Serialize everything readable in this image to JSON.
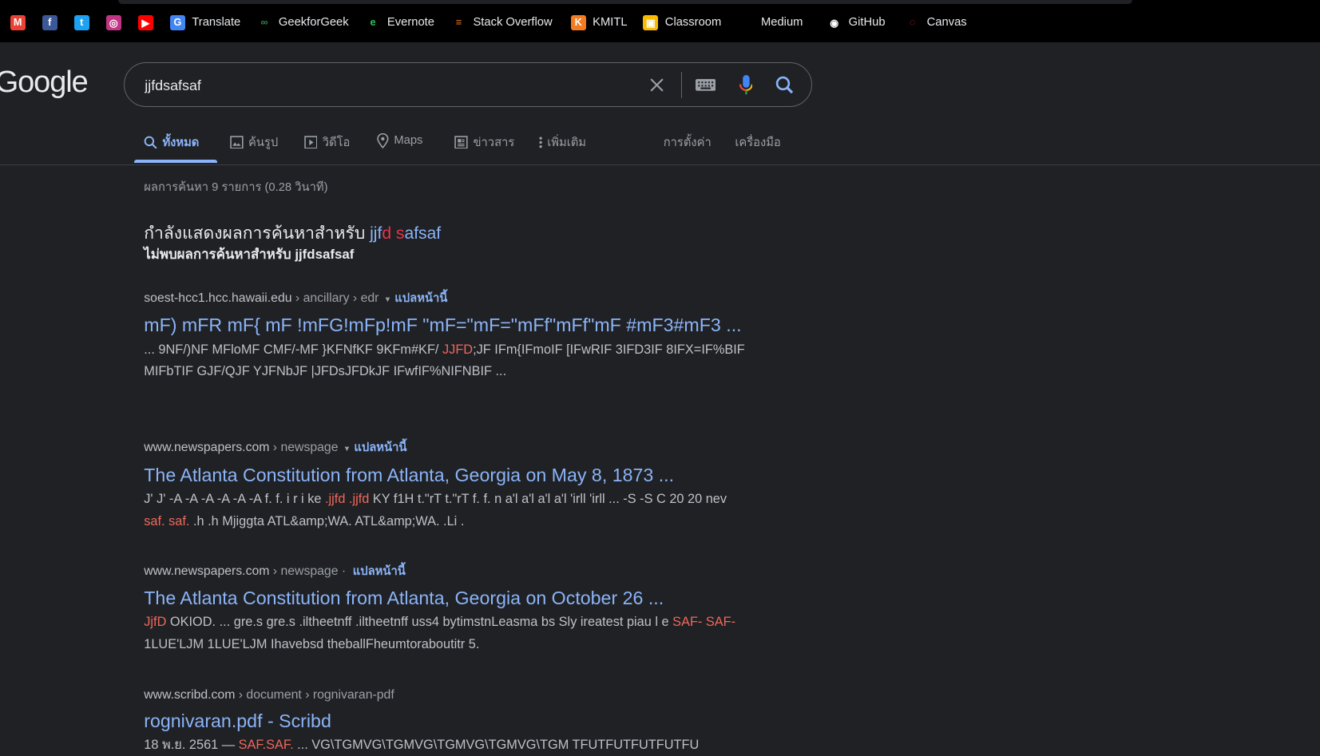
{
  "bookmarks": [
    {
      "label": "",
      "icon": "gmail-icon",
      "color": "#ea4335",
      "glyph": "M"
    },
    {
      "label": "",
      "icon": "facebook-icon",
      "color": "#3b5998",
      "glyph": "f"
    },
    {
      "label": "",
      "icon": "twitter-icon",
      "color": "#1da1f2",
      "glyph": "t"
    },
    {
      "label": "",
      "icon": "instagram-icon",
      "color": "#c13584",
      "glyph": "◎"
    },
    {
      "label": "",
      "icon": "youtube-icon",
      "color": "#ff0000",
      "glyph": "▶"
    },
    {
      "label": "Translate",
      "icon": "google-translate-icon",
      "color": "#4285f4",
      "glyph": "G"
    },
    {
      "label": "GeekforGeek",
      "icon": "geeksforgeeks-icon",
      "color": "#2f8d46",
      "glyph": "∞"
    },
    {
      "label": "Evernote",
      "icon": "evernote-icon",
      "color": "#2dbe60",
      "glyph": "e"
    },
    {
      "label": "Stack Overflow",
      "icon": "stackoverflow-icon",
      "color": "#f48024",
      "glyph": "≡"
    },
    {
      "label": "KMITL",
      "icon": "kmitl-icon",
      "color": "#f47b20",
      "glyph": "K"
    },
    {
      "label": "Classroom",
      "icon": "google-classroom-icon",
      "color": "#f9bb00",
      "glyph": "▣"
    },
    {
      "label": "Medium",
      "icon": "medium-icon",
      "color": "#000000",
      "glyph": "●●"
    },
    {
      "label": "GitHub",
      "icon": "github-icon",
      "color": "#ffffff",
      "glyph": "◉"
    },
    {
      "label": "Canvas",
      "icon": "canvas-icon",
      "color": "#e72429",
      "glyph": "◌"
    }
  ],
  "logo": "Google",
  "search": {
    "value": "jjfdsafsaf"
  },
  "tabs": [
    {
      "label": "ทั้งหมด",
      "icon": "search-icon",
      "active": true
    },
    {
      "label": "ค้นรูป",
      "icon": "image-icon"
    },
    {
      "label": "วิดีโอ",
      "icon": "video-icon"
    },
    {
      "label": "Maps",
      "icon": "map-pin-icon"
    },
    {
      "label": "ข่าวสาร",
      "icon": "news-icon"
    },
    {
      "label": "เพิ่มเติม",
      "icon": "more-vert-icon"
    }
  ],
  "tools": {
    "settings": "การตั้งค่า",
    "tools": "เครื่องมือ"
  },
  "stats": "ผลการค้นหา 9 รายการ (0.28 วินาที)",
  "spelling": {
    "showing_prefix": "กำลังแสดงผลการค้นหาสำหรับ",
    "corrected": [
      {
        "text": "jjf",
        "c": "blue"
      },
      {
        "text": "d",
        "c": "red"
      },
      {
        "text": " ",
        "c": ""
      },
      {
        "text": "s",
        "c": "red"
      },
      {
        "text": "afsaf",
        "c": "blue"
      }
    ],
    "no_results_prefix": "ไม่พบผลการค้นหาสำหรับ",
    "original": "jjfdsafsaf"
  },
  "colors": {
    "link": "#8ab4f8",
    "highlight": "#ee675c",
    "background": "#202124"
  },
  "results": [
    {
      "domain": "soest-hcc1.hcc.hawaii.edu",
      "path": " › ancillary › edr",
      "arrow": true,
      "translate": "แปลหน้านี้",
      "title": "mF) mFR mF{ mF !mFG!mFp!mF \"mF=\"mF=\"mFf\"mFf\"mF #mF3#mF3 ...",
      "snippet": [
        {
          "t": "... 9NF/)NF MFloMF CMF/-MF }KFNfKF 9KFm#KF/ "
        },
        {
          "t": "JJFD",
          "h": true
        },
        {
          "t": ";JF IFm{IFmoIF [IFwRIF 3IFD3IF 8IFX=IF%BIF MIFbTIF GJF/QJF YJFNbJF |JFDsJFDkJF IFwfIF%NIFNBIF ..."
        }
      ]
    },
    {
      "domain": "www.newspapers.com",
      "path": " › newspage",
      "arrow": true,
      "translate": "แปลหน้านี้",
      "title": "The Atlanta Constitution from Atlanta, Georgia on May 8, 1873 ...",
      "snippet": [
        {
          "t": "J' J' -A -A -A -A -A -A f. f. i r i ke "
        },
        {
          "t": ".jjfd .jjfd",
          "h": true
        },
        {
          "t": " KY f1H t.\"rT t.\"rT f. f. n a'l a'l a'l a'l 'irll 'irll ... -S -S C 20 20 nev "
        },
        {
          "t": "saf. saf.",
          "h": true
        },
        {
          "t": " .h .h Mjiggta ATL&amp;WA. ATL&amp;WA. .Li ."
        }
      ]
    },
    {
      "domain": "www.newspapers.com",
      "path": " › newspage · ",
      "arrow": false,
      "translate": "แปลหน้านี้",
      "title": "The Atlanta Constitution from Atlanta, Georgia on October 26 ...",
      "snippet": [
        {
          "t": "JjfD",
          "h": true
        },
        {
          "t": " OKIOD. ... gre.s gre.s .iltheetnff .iltheetnff uss4 bytimstnLeasma bs Sly ireatest piau l e "
        },
        {
          "t": "SAF- SAF-",
          "h": true
        },
        {
          "t": " 1LUE'LJM 1LUE'LJM Ihavebsd theballFheumtoraboutitr 5."
        }
      ]
    },
    {
      "domain": "www.scribd.com",
      "path": " › document › rognivaran-pdf",
      "arrow": false,
      "translate": "",
      "title": "rognivaran.pdf - Scribd",
      "snippet": [
        {
          "t": "18 พ.ย. 2561 — "
        },
        {
          "t": "SAF.SAF.",
          "h": true
        },
        {
          "t": " ... VG\\TGMVG\\TGMVG\\TGMVG\\TGMVG\\TGM TFUTFUTFUTFUTFU"
        }
      ]
    }
  ]
}
